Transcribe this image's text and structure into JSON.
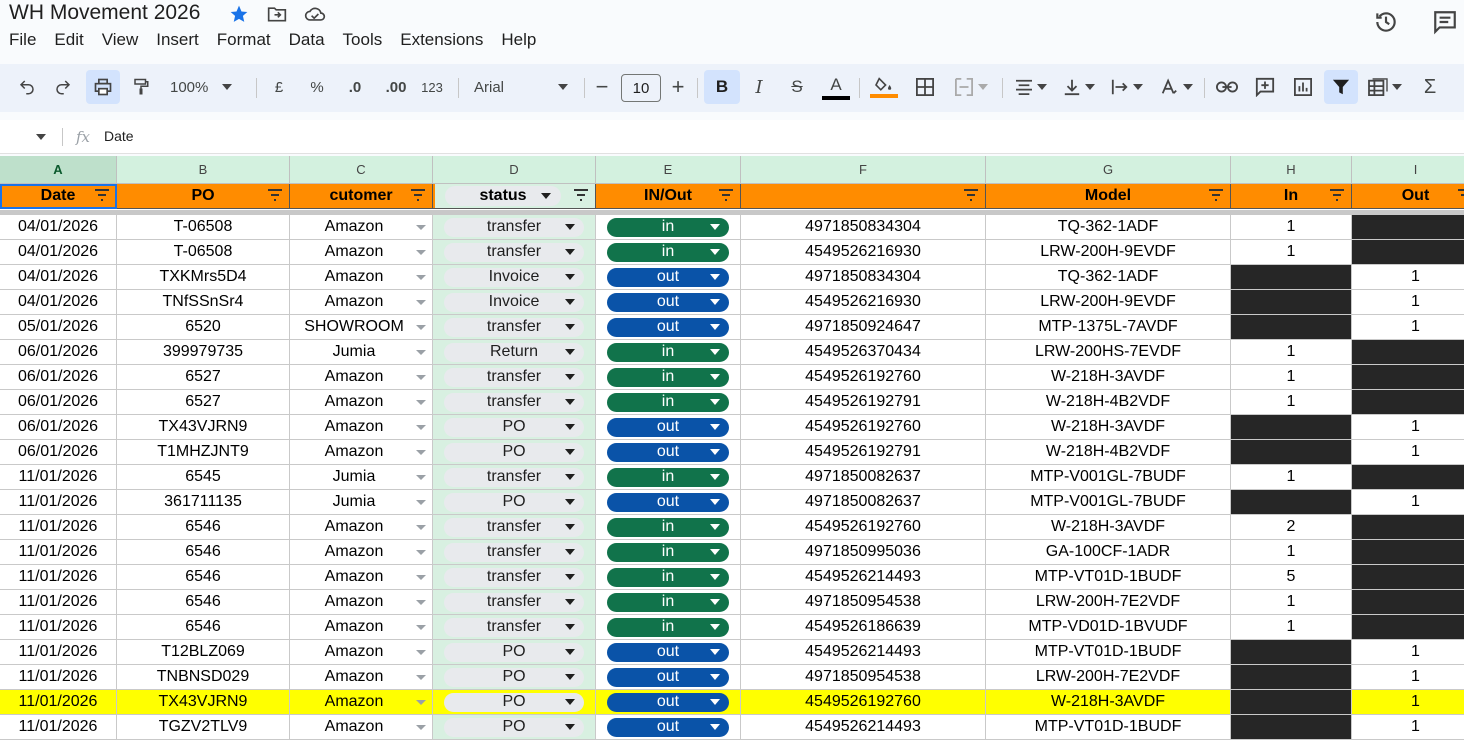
{
  "doc": {
    "title": "WH Movement 2026"
  },
  "menu": [
    "File",
    "Edit",
    "View",
    "Insert",
    "Format",
    "Data",
    "Tools",
    "Extensions",
    "Help"
  ],
  "toolbar": {
    "zoom": "100%",
    "currency": "£",
    "percent": "%",
    "dec_dec": ".0",
    "dec_inc": ".00",
    "number_format": "123",
    "font": "Arial",
    "font_size": "10",
    "bold": "B",
    "italic": "I",
    "strike": "S",
    "text_color": "A",
    "sum": "Σ"
  },
  "formula": {
    "fx": "fx",
    "value": "Date"
  },
  "columns": [
    "A",
    "B",
    "C",
    "D",
    "E",
    "F",
    "G",
    "H",
    "I"
  ],
  "headers": [
    "Date",
    "PO",
    "cutomer",
    "status",
    "IN/Out",
    "",
    "Model",
    "In",
    "Out"
  ],
  "rows": [
    [
      "04/01/2026",
      "T-06508",
      "Amazon",
      "transfer",
      "in",
      "4971850834304",
      "TQ-362-1ADF",
      "1",
      ""
    ],
    [
      "04/01/2026",
      "T-06508",
      "Amazon",
      "transfer",
      "in",
      "4549526216930",
      "LRW-200H-9EVDF",
      "1",
      ""
    ],
    [
      "04/01/2026",
      "TXKMrs5D4",
      "Amazon",
      "Invoice",
      "out",
      "4971850834304",
      "TQ-362-1ADF",
      "",
      "1"
    ],
    [
      "04/01/2026",
      "TNfSSnSr4",
      "Amazon",
      "Invoice",
      "out",
      "4549526216930",
      "LRW-200H-9EVDF",
      "",
      "1"
    ],
    [
      "05/01/2026",
      "6520",
      "SHOWROOM",
      "transfer",
      "out",
      "4971850924647",
      "MTP-1375L-7AVDF",
      "",
      "1"
    ],
    [
      "06/01/2026",
      "399979735",
      "Jumia",
      "Return",
      "in",
      "4549526370434",
      "LRW-200HS-7EVDF",
      "1",
      ""
    ],
    [
      "06/01/2026",
      "6527",
      "Amazon",
      "transfer",
      "in",
      "4549526192760",
      "W-218H-3AVDF",
      "1",
      ""
    ],
    [
      "06/01/2026",
      "6527",
      "Amazon",
      "transfer",
      "in",
      "4549526192791",
      "W-218H-4B2VDF",
      "1",
      ""
    ],
    [
      "06/01/2026",
      "TX43VJRN9",
      "Amazon",
      "PO",
      "out",
      "4549526192760",
      "W-218H-3AVDF",
      "",
      "1"
    ],
    [
      "06/01/2026",
      "T1MHZJNT9",
      "Amazon",
      "PO",
      "out",
      "4549526192791",
      "W-218H-4B2VDF",
      "",
      "1"
    ],
    [
      "11/01/2026",
      "6545",
      "Jumia",
      "transfer",
      "in",
      "4971850082637",
      "MTP-V001GL-7BUDF",
      "1",
      ""
    ],
    [
      "11/01/2026",
      "361711135",
      "Jumia",
      "PO",
      "out",
      "4971850082637",
      "MTP-V001GL-7BUDF",
      "",
      "1"
    ],
    [
      "11/01/2026",
      "6546",
      "Amazon",
      "transfer",
      "in",
      "4549526192760",
      "W-218H-3AVDF",
      "2",
      ""
    ],
    [
      "11/01/2026",
      "6546",
      "Amazon",
      "transfer",
      "in",
      "4971850995036",
      "GA-100CF-1ADR",
      "1",
      ""
    ],
    [
      "11/01/2026",
      "6546",
      "Amazon",
      "transfer",
      "in",
      "4549526214493",
      "MTP-VT01D-1BUDF",
      "5",
      ""
    ],
    [
      "11/01/2026",
      "6546",
      "Amazon",
      "transfer",
      "in",
      "4971850954538",
      "LRW-200H-7E2VDF",
      "1",
      ""
    ],
    [
      "11/01/2026",
      "6546",
      "Amazon",
      "transfer",
      "in",
      "4549526186639",
      "MTP-VD01D-1BVUDF",
      "1",
      ""
    ],
    [
      "11/01/2026",
      "T12BLZ069",
      "Amazon",
      "PO",
      "out",
      "4549526214493",
      "MTP-VT01D-1BUDF",
      "",
      "1"
    ],
    [
      "11/01/2026",
      "TNBNSD029",
      "Amazon",
      "PO",
      "out",
      "4971850954538",
      "LRW-200H-7E2VDF",
      "",
      "1"
    ],
    [
      "11/01/2026",
      "TX43VJRN9",
      "Amazon",
      "PO",
      "out",
      "4549526192760",
      "W-218H-3AVDF",
      "",
      "1"
    ],
    [
      "11/01/2026",
      "TGZV2TLV9",
      "Amazon",
      "PO",
      "out",
      "4549526214493",
      "MTP-VT01D-1BUDF",
      "",
      "1"
    ]
  ],
  "highlight_row_index": 19,
  "colors": {
    "header": "#ff8c00",
    "in_chip": "#11734b",
    "out_chip": "#0a53a8",
    "highlight": "#ffff00",
    "dark_cell": "#262626"
  }
}
